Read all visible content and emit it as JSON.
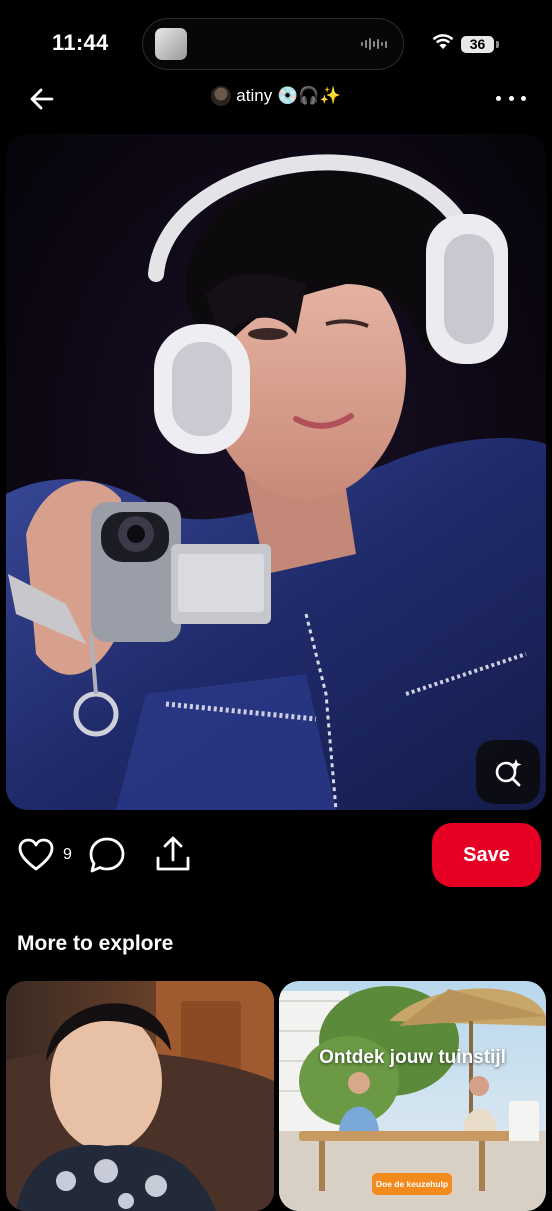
{
  "status_bar": {
    "time": "11:44",
    "battery": "36"
  },
  "header": {
    "back_icon": "arrow-left-icon",
    "board_title": "atiny",
    "board_emoji": "💿🎧✨",
    "more_icon": "more-horizontal-icon"
  },
  "pin": {
    "image_description_icon": "photo",
    "visual_search_icon": "visual-search-sparkle-icon"
  },
  "actions": {
    "like_count": "9",
    "save_label": "Save"
  },
  "explore": {
    "title": "More to explore",
    "cards": [
      {
        "type": "pin"
      },
      {
        "type": "ad",
        "headline": "Ontdek jouw tuinstijl",
        "cta": "Doe de keuzehulp"
      }
    ]
  },
  "colors": {
    "background": "#000000",
    "save_button": "#e60023",
    "ad_cta": "#f28a1e"
  }
}
